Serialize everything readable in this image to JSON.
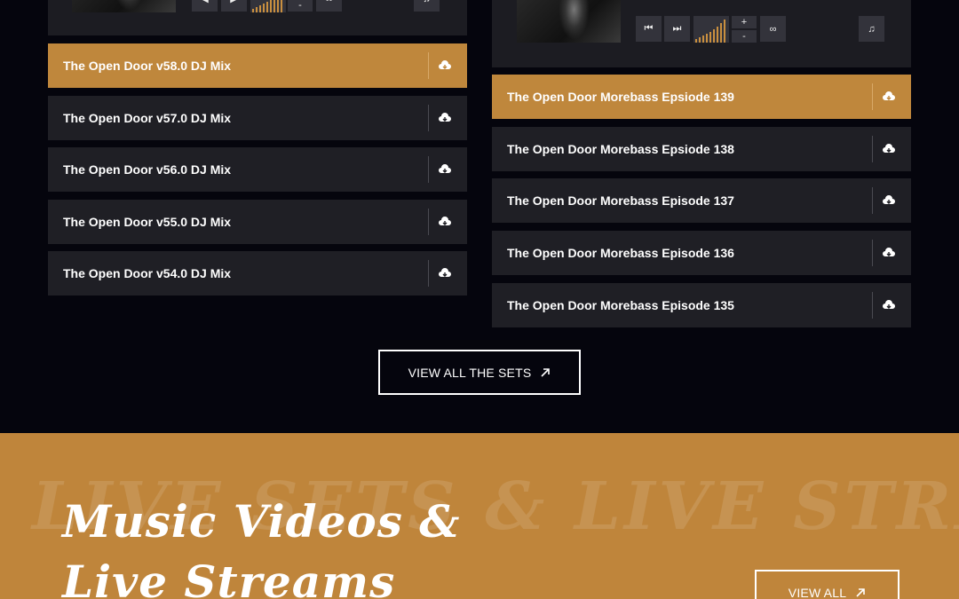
{
  "left_player": {
    "tracks": [
      {
        "title": "The Open Door v58.0 DJ Mix",
        "active": true
      },
      {
        "title": "The Open Door v57.0 DJ Mix",
        "active": false
      },
      {
        "title": "The Open Door v56.0 DJ Mix",
        "active": false
      },
      {
        "title": "The Open Door v55.0 DJ Mix",
        "active": false
      },
      {
        "title": "The Open Door v54.0 DJ Mix",
        "active": false
      }
    ]
  },
  "right_player": {
    "volume_plus": "+",
    "volume_minus": "-",
    "tracks": [
      {
        "title": "The Open Door Morebass Epsiode 139",
        "active": true
      },
      {
        "title": "The Open Door Morebass Epsiode 138",
        "active": false
      },
      {
        "title": "The Open Door Morebass Episode 137",
        "active": false
      },
      {
        "title": "The Open Door Morebass Episode 136",
        "active": false
      },
      {
        "title": "The Open Door Morebass Episode 135",
        "active": false
      }
    ]
  },
  "view_all_sets": {
    "label": "VIEW ALL THE SETS",
    "icon": "arrow-up-right-icon"
  },
  "videos_section": {
    "background_text": "LIVE SETS & LIVE STREAMS",
    "heading_line1": "Music Videos &",
    "heading_line2": "Live Streams",
    "view_all_label": "VIEW ALL",
    "accent_color": "#bf853b"
  },
  "colors": {
    "active_track": "#bf873c",
    "track_bg": "#1f1f25",
    "page_bg": "#05050d"
  }
}
